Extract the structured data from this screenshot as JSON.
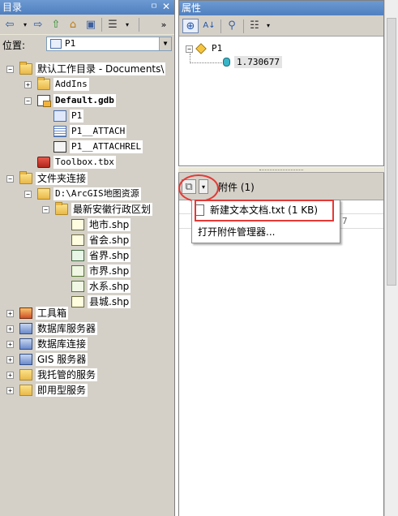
{
  "catalog": {
    "title": "目录",
    "pin_glyph": "ㅁ",
    "close_glyph": "✕",
    "toolbar": {
      "back": "⇦",
      "forward": "⇨",
      "up": "⇧",
      "home": "⌂",
      "connect": "▣",
      "view": "☰",
      "more": "»"
    },
    "location_label": "位置:",
    "location_value": "P1",
    "tree": [
      {
        "label": "默认工作目录 - Documents\\"
      },
      {
        "label": "AddIns"
      },
      {
        "label": "Default.gdb"
      },
      {
        "label": "P1"
      },
      {
        "label": "P1__ATTACH"
      },
      {
        "label": "P1__ATTACHREL"
      },
      {
        "label": "Toolbox.tbx"
      },
      {
        "label": "文件夹连接"
      },
      {
        "label": "D:\\ArcGIS地图资源"
      },
      {
        "label": "最新安徽行政区划"
      },
      {
        "label": "地市.shp"
      },
      {
        "label": "省会.shp"
      },
      {
        "label": "省界.shp"
      },
      {
        "label": "市界.shp"
      },
      {
        "label": "水系.shp"
      },
      {
        "label": "县城.shp"
      },
      {
        "label": "工具箱"
      },
      {
        "label": "数据库服务器"
      },
      {
        "label": "数据库连接"
      },
      {
        "label": "GIS 服务器"
      },
      {
        "label": "我托管的服务"
      },
      {
        "label": "即用型服务"
      }
    ]
  },
  "properties": {
    "title": "属性",
    "tree_root": "P1",
    "tree_value": "1.730677"
  },
  "attachments": {
    "label": "附件 (1)",
    "menu": {
      "new_doc": "新建文本文档.txt (1 KB)",
      "open_manager": "打开附件管理器..."
    },
    "partial_text": "7"
  },
  "colors": {
    "title_bar": "#5a89c8",
    "highlight": "#e53935"
  }
}
